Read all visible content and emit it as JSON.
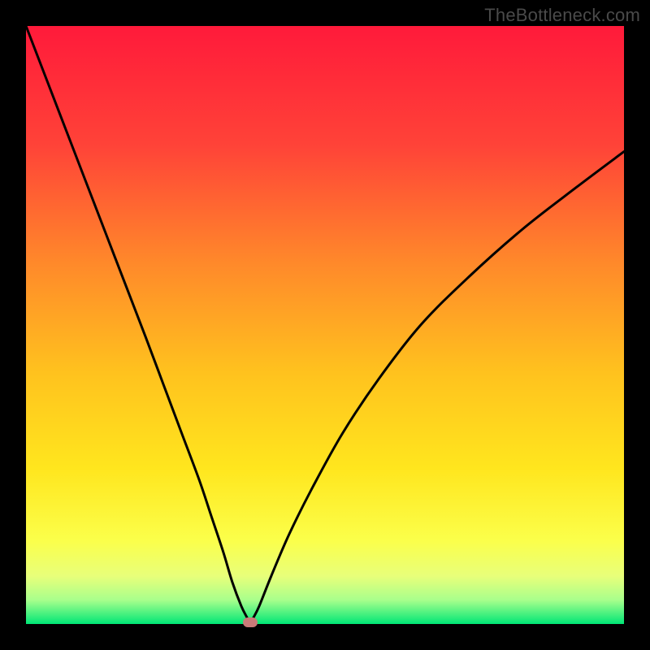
{
  "watermark": "TheBottleneck.com",
  "chart_data": {
    "type": "line",
    "title": "",
    "xlabel": "",
    "ylabel": "",
    "xlim": [
      0,
      100
    ],
    "ylim": [
      0,
      100
    ],
    "series": [
      {
        "name": "bottleneck-curve",
        "x": [
          0,
          5,
          10,
          15,
          20,
          23,
          26,
          29,
          31,
          33,
          34.5,
          36,
          37,
          37.5,
          38,
          39,
          41,
          44,
          48,
          53,
          59,
          66,
          74,
          83,
          92,
          100
        ],
        "values": [
          100,
          87,
          74,
          61,
          48,
          40,
          32,
          24,
          18,
          12,
          7,
          3,
          1,
          0,
          1,
          3,
          8,
          15,
          23,
          32,
          41,
          50,
          58,
          66,
          73,
          79
        ]
      }
    ],
    "marker": {
      "x": 37.5,
      "y": 0,
      "color": "#c97a78"
    },
    "gradient_stops": [
      {
        "pos": 0.0,
        "color": "#ff1a3a"
      },
      {
        "pos": 0.2,
        "color": "#ff4338"
      },
      {
        "pos": 0.4,
        "color": "#ff8a2a"
      },
      {
        "pos": 0.58,
        "color": "#ffc21e"
      },
      {
        "pos": 0.74,
        "color": "#ffe61e"
      },
      {
        "pos": 0.86,
        "color": "#fbff4a"
      },
      {
        "pos": 0.92,
        "color": "#e8ff7a"
      },
      {
        "pos": 0.96,
        "color": "#a8ff8c"
      },
      {
        "pos": 1.0,
        "color": "#00e676"
      }
    ]
  }
}
